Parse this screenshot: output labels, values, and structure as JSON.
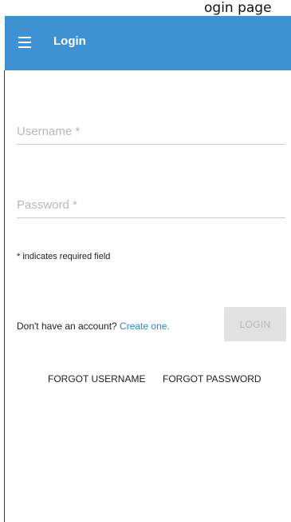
{
  "page": {
    "top_strip_text": "ogin page"
  },
  "app_bar": {
    "title": "Login",
    "menu_icon": "hamburger-menu-icon",
    "color": "#3f92d2"
  },
  "form": {
    "username": {
      "placeholder": "Username *",
      "value": ""
    },
    "password": {
      "placeholder": "Password *",
      "value": ""
    },
    "required_hint": "* indicates required field",
    "signup_prompt": "Don't have an account?",
    "signup_link": "Create one.",
    "link_color": "#2f86c8",
    "login_button": "LOGIN",
    "login_enabled": false
  },
  "footer_links": {
    "forgot_username": "FORGOT USERNAME",
    "forgot_password": "FORGOT PASSWORD"
  }
}
